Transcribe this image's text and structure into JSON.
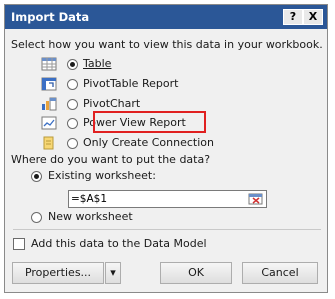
{
  "dialog": {
    "title": "Import Data",
    "help_button": "?",
    "close_button": "X"
  },
  "view_section": {
    "prompt": "Select how you want to view this data in your workbook.",
    "options": [
      {
        "label": "Table",
        "selected": true,
        "icon": "table-icon"
      },
      {
        "label": "PivotTable Report",
        "selected": false,
        "icon": "pivottable-icon"
      },
      {
        "label": "PivotChart",
        "selected": false,
        "icon": "pivotchart-icon"
      },
      {
        "label": "Power View Report",
        "selected": false,
        "icon": "power-view-icon"
      },
      {
        "label": "Only Create Connection",
        "selected": false,
        "icon": "connection-icon"
      }
    ]
  },
  "location_section": {
    "prompt": "Where do you want to put the data?",
    "existing_label": "Existing worksheet:",
    "existing_selected": true,
    "cell_value": "=$A$1",
    "new_label": "New worksheet",
    "new_selected": false
  },
  "data_model": {
    "label": "Add this data to the Data Model",
    "checked": false
  },
  "buttons": {
    "properties": "Properties...",
    "properties_arrow": "▾",
    "ok": "OK",
    "cancel": "Cancel"
  },
  "colors": {
    "titlebar": "#2b5797",
    "highlight": "#e02020"
  }
}
